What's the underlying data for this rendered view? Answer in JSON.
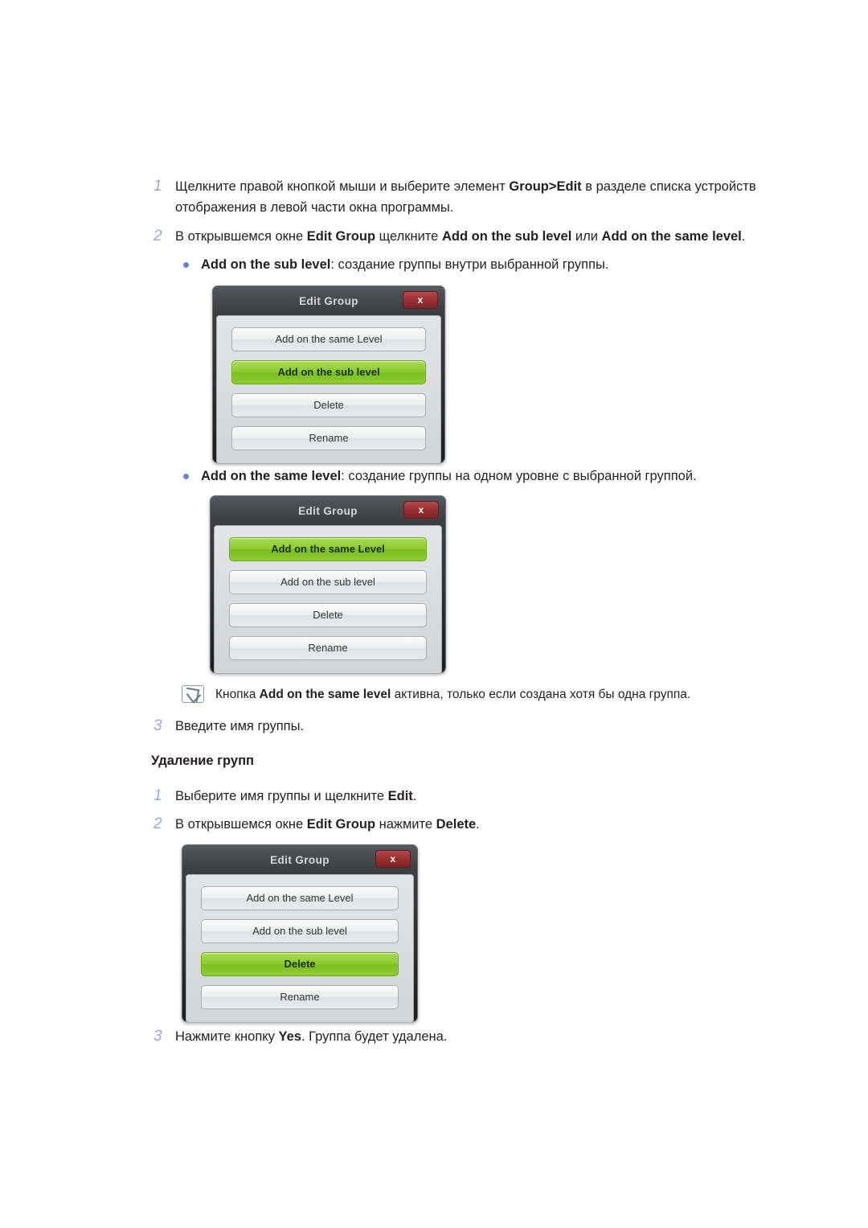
{
  "steps": {
    "s1_num": "1",
    "s1_text_a": "Щелкните правой кнопкой мыши и выберите элемент ",
    "s1_bold": "Group>Edit",
    "s1_text_b": " в разделе списка устройств отображения в левой части окна программы.",
    "s2_num": "2",
    "s2_text_a": "В открывшемся окне ",
    "s2_bold1": "Edit Group",
    "s2_text_b": " щелкните ",
    "s2_bold2": "Add on the sub level",
    "s2_text_c": " или ",
    "s2_bold3": "Add on the same level",
    "s2_text_d": ".",
    "s3_num": "3",
    "s3_text": "Введите имя группы."
  },
  "bullets": {
    "b1_bold": "Add on the sub level",
    "b1_text": ": создание группы внутри выбранной группы.",
    "b2_bold": "Add on the same level",
    "b2_text": ": создание группы на одном уровне с выбранной группой."
  },
  "note": {
    "text_a": "Кнопка ",
    "bold": "Add on the same level",
    "text_b": " активна, только если создана хотя бы одна группа.",
    "icon": "note-pencil-icon"
  },
  "section": {
    "title": "Удаление групп"
  },
  "delete_steps": {
    "d1_num": "1",
    "d1_text_a": "Выберите имя группы и щелкните ",
    "d1_bold": "Edit",
    "d1_text_b": ".",
    "d2_num": "2",
    "d2_text_a": "В открывшемся окне ",
    "d2_bold1": "Edit Group",
    "d2_text_b": " нажмите ",
    "d2_bold2": "Delete",
    "d2_text_c": ".",
    "d3_num": "3",
    "d3_text_a": "Нажмите кнопку ",
    "d3_bold": "Yes",
    "d3_text_b": ". Группа будет удалена."
  },
  "dialog1": {
    "title": "Edit Group",
    "close": "x",
    "buttons": [
      {
        "label": "Add on the same Level",
        "active": false
      },
      {
        "label": "Add on the sub level",
        "active": true
      },
      {
        "label": "Delete",
        "active": false
      },
      {
        "label": "Rename",
        "active": false
      }
    ]
  },
  "dialog2": {
    "title": "Edit Group",
    "close": "x",
    "buttons": [
      {
        "label": "Add on the same Level",
        "active": true
      },
      {
        "label": "Add on the sub level",
        "active": false
      },
      {
        "label": "Delete",
        "active": false
      },
      {
        "label": "Rename",
        "active": false
      }
    ]
  },
  "dialog3": {
    "title": "Edit Group",
    "close": "x",
    "buttons": [
      {
        "label": "Add on the same Level",
        "active": false
      },
      {
        "label": "Add on the sub level",
        "active": false
      },
      {
        "label": "Delete",
        "active": true
      },
      {
        "label": "Rename",
        "active": false
      }
    ]
  },
  "colors": {
    "accent_green": "#8ccb32",
    "step_number": "#9aa7d4",
    "bullet": "#6d83c4",
    "close_red": "#993033"
  }
}
